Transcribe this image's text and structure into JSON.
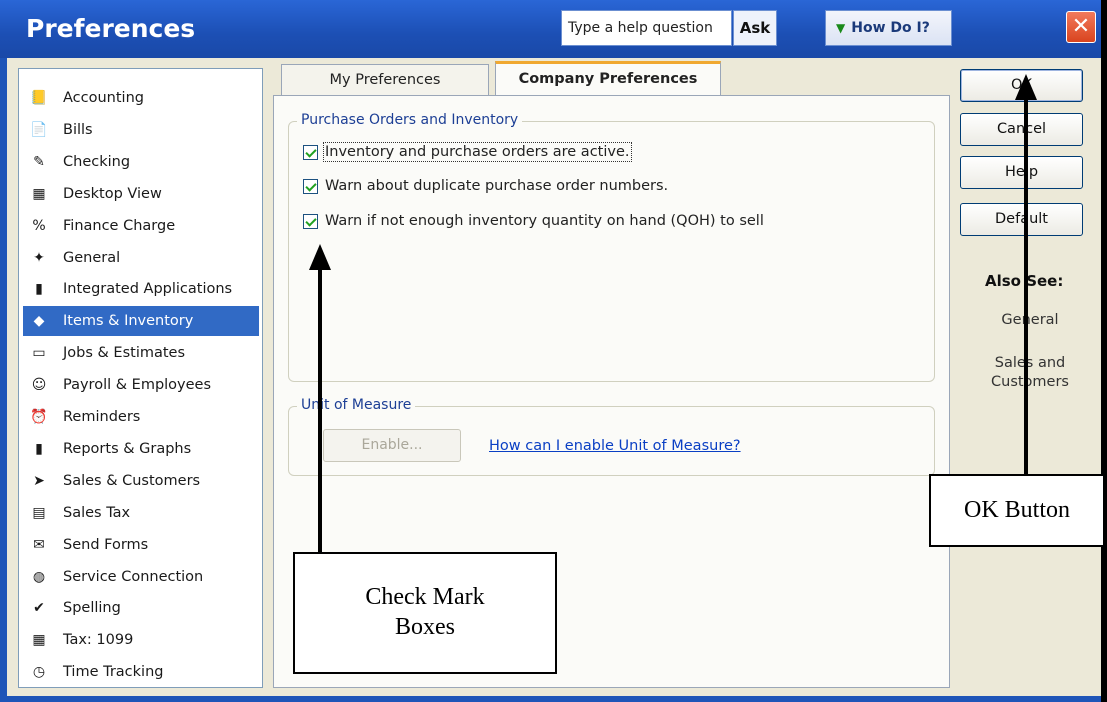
{
  "window": {
    "title": "Preferences",
    "help_placeholder": "Type a help question",
    "ask_label": "Ask",
    "howdoi_label": "How Do I?",
    "close_label": "✕"
  },
  "sidebar": {
    "items": [
      {
        "label": "Accounting",
        "icon": "📒"
      },
      {
        "label": "Bills",
        "icon": "📄"
      },
      {
        "label": "Checking",
        "icon": "✎"
      },
      {
        "label": "Desktop View",
        "icon": "▦"
      },
      {
        "label": "Finance Charge",
        "icon": "%"
      },
      {
        "label": "General",
        "icon": "✦"
      },
      {
        "label": "Integrated Applications",
        "icon": "▮"
      },
      {
        "label": "Items & Inventory",
        "icon": "◆"
      },
      {
        "label": "Jobs & Estimates",
        "icon": "▭"
      },
      {
        "label": "Payroll & Employees",
        "icon": "☺"
      },
      {
        "label": "Reminders",
        "icon": "⏰"
      },
      {
        "label": "Reports & Graphs",
        "icon": "▮"
      },
      {
        "label": "Sales & Customers",
        "icon": "➤"
      },
      {
        "label": "Sales Tax",
        "icon": "▤"
      },
      {
        "label": "Send Forms",
        "icon": "✉"
      },
      {
        "label": "Service Connection",
        "icon": "◍"
      },
      {
        "label": "Spelling",
        "icon": "✔"
      },
      {
        "label": "Tax: 1099",
        "icon": "▦"
      },
      {
        "label": "Time Tracking",
        "icon": "◷"
      }
    ],
    "selected_index": 7
  },
  "tabs": {
    "my_preferences": "My Preferences",
    "company_preferences": "Company Preferences"
  },
  "purchase_group": {
    "legend": "Purchase Orders and Inventory",
    "options": [
      {
        "label": "Inventory and purchase orders are active.",
        "checked": true
      },
      {
        "label": "Warn about duplicate purchase order numbers.",
        "checked": true
      },
      {
        "label": "Warn if not enough inventory quantity on hand (QOH) to sell",
        "checked": true
      }
    ]
  },
  "uom_group": {
    "legend": "Unit of Measure",
    "enable_label": "Enable...",
    "help_link": "How can I enable Unit of Measure?"
  },
  "buttons": {
    "ok": "OK",
    "cancel": "Cancel",
    "help": "Help",
    "default": "Default"
  },
  "also_see": {
    "heading": "Also See:",
    "links": [
      "General",
      "Sales and\nCustomers"
    ]
  },
  "callouts": {
    "checkmarks": "Check Mark\nBoxes",
    "ok": "OK Button"
  }
}
